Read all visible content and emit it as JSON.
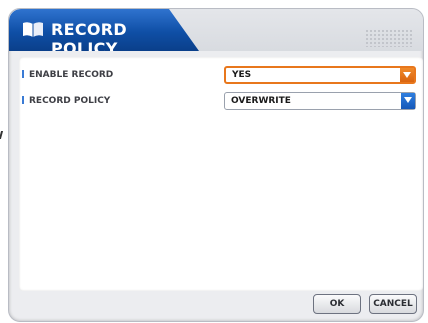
{
  "dialog": {
    "title": "RECORD POLICY",
    "title_icon": "book-icon",
    "accent_color": "#0f4fa6"
  },
  "settings": [
    {
      "label": "ENABLE RECORD",
      "value": "YES",
      "focused": true,
      "arrow_color": "#e8771c"
    },
    {
      "label": "RECORD POLICY",
      "value": "OVERWRITE",
      "focused": false,
      "arrow_color": "#1f6bd0"
    }
  ],
  "buttons": {
    "ok_label": "OK",
    "cancel_label": "CANCEL"
  }
}
